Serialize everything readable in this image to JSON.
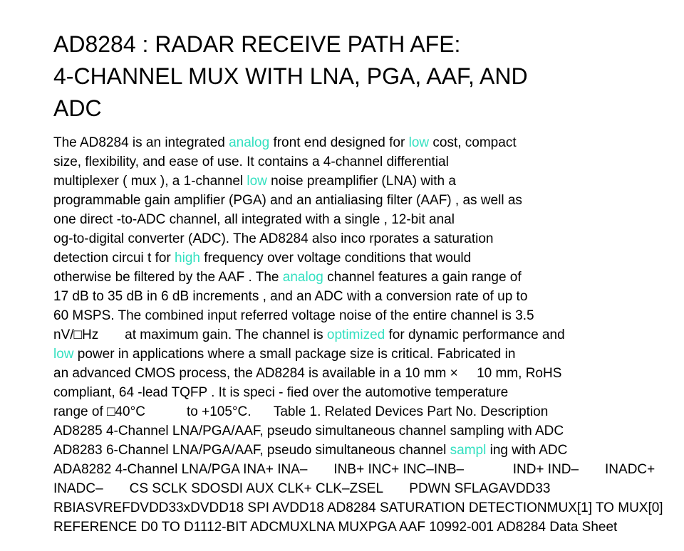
{
  "document": {
    "title_lines": [
      "AD8284 : RADAR RECEIVE PATH AFE:",
      "4-CHANNEL MUX WITH LNA, PGA, AAF, AND",
      "ADC"
    ],
    "highlight_color": "#33e0c0",
    "body_lines": [
      [
        {
          "t": "The AD8284 is an integrated "
        },
        {
          "t": "analog",
          "hl": true
        },
        {
          "t": " front end designed for "
        },
        {
          "t": "low",
          "hl": true
        },
        {
          "t": " cost, compact"
        }
      ],
      [
        {
          "t": "size, flexibility, and ease of use. It contains a 4-channel differential"
        }
      ],
      [
        {
          "t": "multiplexer ( mux ), a 1-channel "
        },
        {
          "t": "low",
          "hl": true
        },
        {
          "t": " noise preamplifier (LNA) with a"
        }
      ],
      [
        {
          "t": "programmable gain amplifier (PGA) and an antialiasing filter (AAF) , as well as"
        }
      ],
      [
        {
          "t": "one direct -to-ADC channel, all integrated with a single , 12-bit anal"
        }
      ],
      [
        {
          "t": "og-to-digital converter (ADC). The AD8284 also inco rporates a saturation"
        }
      ],
      [
        {
          "t": "detection circui t for "
        },
        {
          "t": "high",
          "hl": true
        },
        {
          "t": " frequency over voltage conditions that would"
        }
      ],
      [
        {
          "t": "otherwise be filtered by the AAF . The "
        },
        {
          "t": "analog",
          "hl": true
        },
        {
          "t": " channel features a gain range of"
        }
      ],
      [
        {
          "t": "17 dB to 35 dB in 6 dB increments , and an ADC with a conversion rate of up to"
        }
      ],
      [
        {
          "t": "60 MSPS. The combined input referred voltage noise of the entire channel is 3.5"
        }
      ],
      [
        {
          "t": "nV/□Hz       at maximum gain. The channel is "
        },
        {
          "t": "optimized",
          "hl": true
        },
        {
          "t": " for dynamic performance and"
        }
      ],
      [
        {
          "t": "low",
          "hl": true
        },
        {
          "t": " power in applications where a small package size is critical. Fabricated in"
        }
      ],
      [
        {
          "t": "an advanced CMOS process, the AD8284 is available in a 10 mm ×     10 mm, RoHS"
        }
      ],
      [
        {
          "t": "compliant, 64 -lead TQFP . It is speci - fied over the automotive temperature"
        }
      ],
      [
        {
          "t": "range of □40°C           to +105°C.      Table 1. Related Devices Part No. Description"
        }
      ],
      [
        {
          "t": "AD8285 4-Channel LNA/PGA/AAF, pseudo simultaneous channel sampling with ADC"
        }
      ],
      [
        {
          "t": "AD8283 6-Channel LNA/PGA/AAF, pseudo simultaneous channel "
        },
        {
          "t": "sampl",
          "hl": true
        },
        {
          "t": " ing with ADC"
        }
      ],
      [
        {
          "t": "ADA8282 4-Channel LNA/PGA INA+ INA–       INB+ INC+ INC–INB–             IND+ IND–       INADC+"
        }
      ],
      [
        {
          "t": "INADC–       CS SCLK SDOSDI AUX CLK+ CLK–ZSEL       PDWN SFLAGAVDD33"
        }
      ],
      [
        {
          "t": "RBIASVREFDVDD33xDVDD18 SPI AVDD18 AD8284 SATURATION DETECTIONMUX[1] TO MUX[0]"
        }
      ],
      [
        {
          "t": "REFERENCE D0 TO D1112-BIT ADCMUXLNA MUXPGA AAF 10992-001 AD8284 Data Sheet"
        }
      ]
    ]
  }
}
